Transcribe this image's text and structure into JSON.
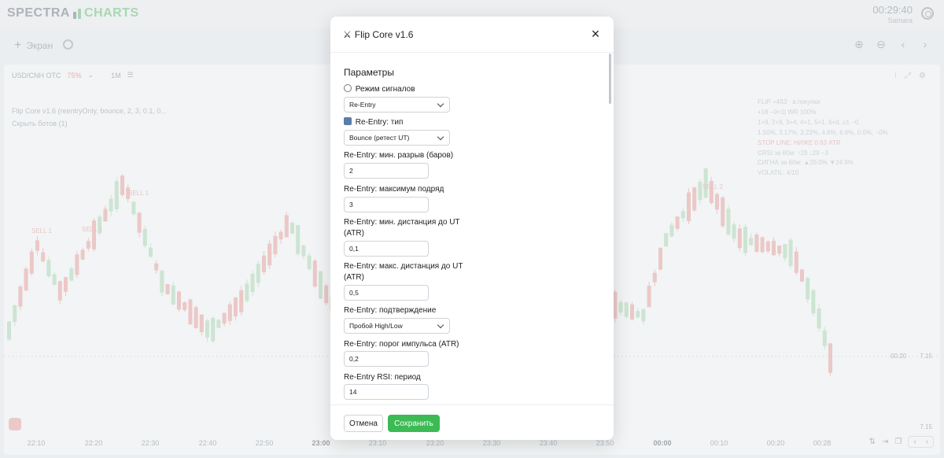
{
  "app": {
    "logo_left": "SPECTRA",
    "logo_right": "CHARTS",
    "time": "00:29:40",
    "city": "Samara"
  },
  "toolbar": {
    "screen_label": "Экран"
  },
  "chart_panel": {
    "pair": "USD/CNH OTC",
    "payout": "75%",
    "timeframe": "1M",
    "indicator_line": "Flip Core v1.6 (reentryOnly, bounce, 2, 3, 0.1, 0...",
    "hide_bots": "Скрыть ботов (1)",
    "info": [
      {
        "text": "FLIP +4ß3 · в.покупки",
        "tone": "neutral"
      },
      {
        "text": "+18 −0=1| WR 100%",
        "tone": "neutral"
      },
      {
        "text": "1+9, 2+9, 3+4, 4+1, 5+1, 6+0, ≥1 −0",
        "tone": "neutral"
      },
      {
        "text": "1.50%, 3.17%, 3.22%, 4.6%, 6.6%, 0.0%, −0%",
        "tone": "neutral"
      },
      {
        "text": "STOP LINE: НИЖЕ 0.63 ATR",
        "tone": "red"
      },
      {
        "text": "CRSI за 60м: ↑29 ↓29 −3",
        "tone": "neutral"
      },
      {
        "text": "СИГНА за 60м: ▲26.0% ▼24.9%",
        "tone": "neutral"
      },
      {
        "text": "VOLATIL: 4/10",
        "tone": "neutral"
      }
    ],
    "price_main": "7.15",
    "price_bottom": "7.15",
    "countdown": "00:20",
    "x_labels": [
      "22:10",
      "22:20",
      "22:30",
      "22:40",
      "22:50",
      "23:00",
      "23:10",
      "23:20",
      "23:30",
      "23:40",
      "23:50",
      "00:00",
      "00:10",
      "00:20",
      "00:28"
    ],
    "sell_labels": [
      "SELL 1",
      "SELL 1",
      "SELL 1",
      "SELL 2"
    ]
  },
  "modal": {
    "title": "Flip Core v1.6",
    "section": "Параметры",
    "fields": [
      {
        "label": "Режим сигналов",
        "value": "Re-Entry"
      },
      {
        "label": "Re-Entry: тип",
        "value": "Bounce (ретест UT)"
      },
      {
        "label": "Re-Entry: мин. разрыв (баров)",
        "value": "2"
      },
      {
        "label": "Re-Entry: максимум подряд",
        "value": "3"
      },
      {
        "label": "Re-Entry: мин. дистанция до UT (ATR)",
        "value": "0,1"
      },
      {
        "label": "Re-Entry: макс. дистанция до UT (ATR)",
        "value": "0,5"
      },
      {
        "label": "Re-Entry: подтверждение",
        "value": "Пробой High/Low"
      },
      {
        "label": "Re-Entry: порог импульса (ATR)",
        "value": "0,2"
      },
      {
        "label": "Re-Entry RSI: период",
        "value": "14"
      }
    ],
    "cancel_label": "Отмена",
    "save_label": "Сохранить"
  },
  "colors": {
    "up": "#bfe3c4",
    "down": "#f3b3b0",
    "accent": "#3cba54"
  }
}
